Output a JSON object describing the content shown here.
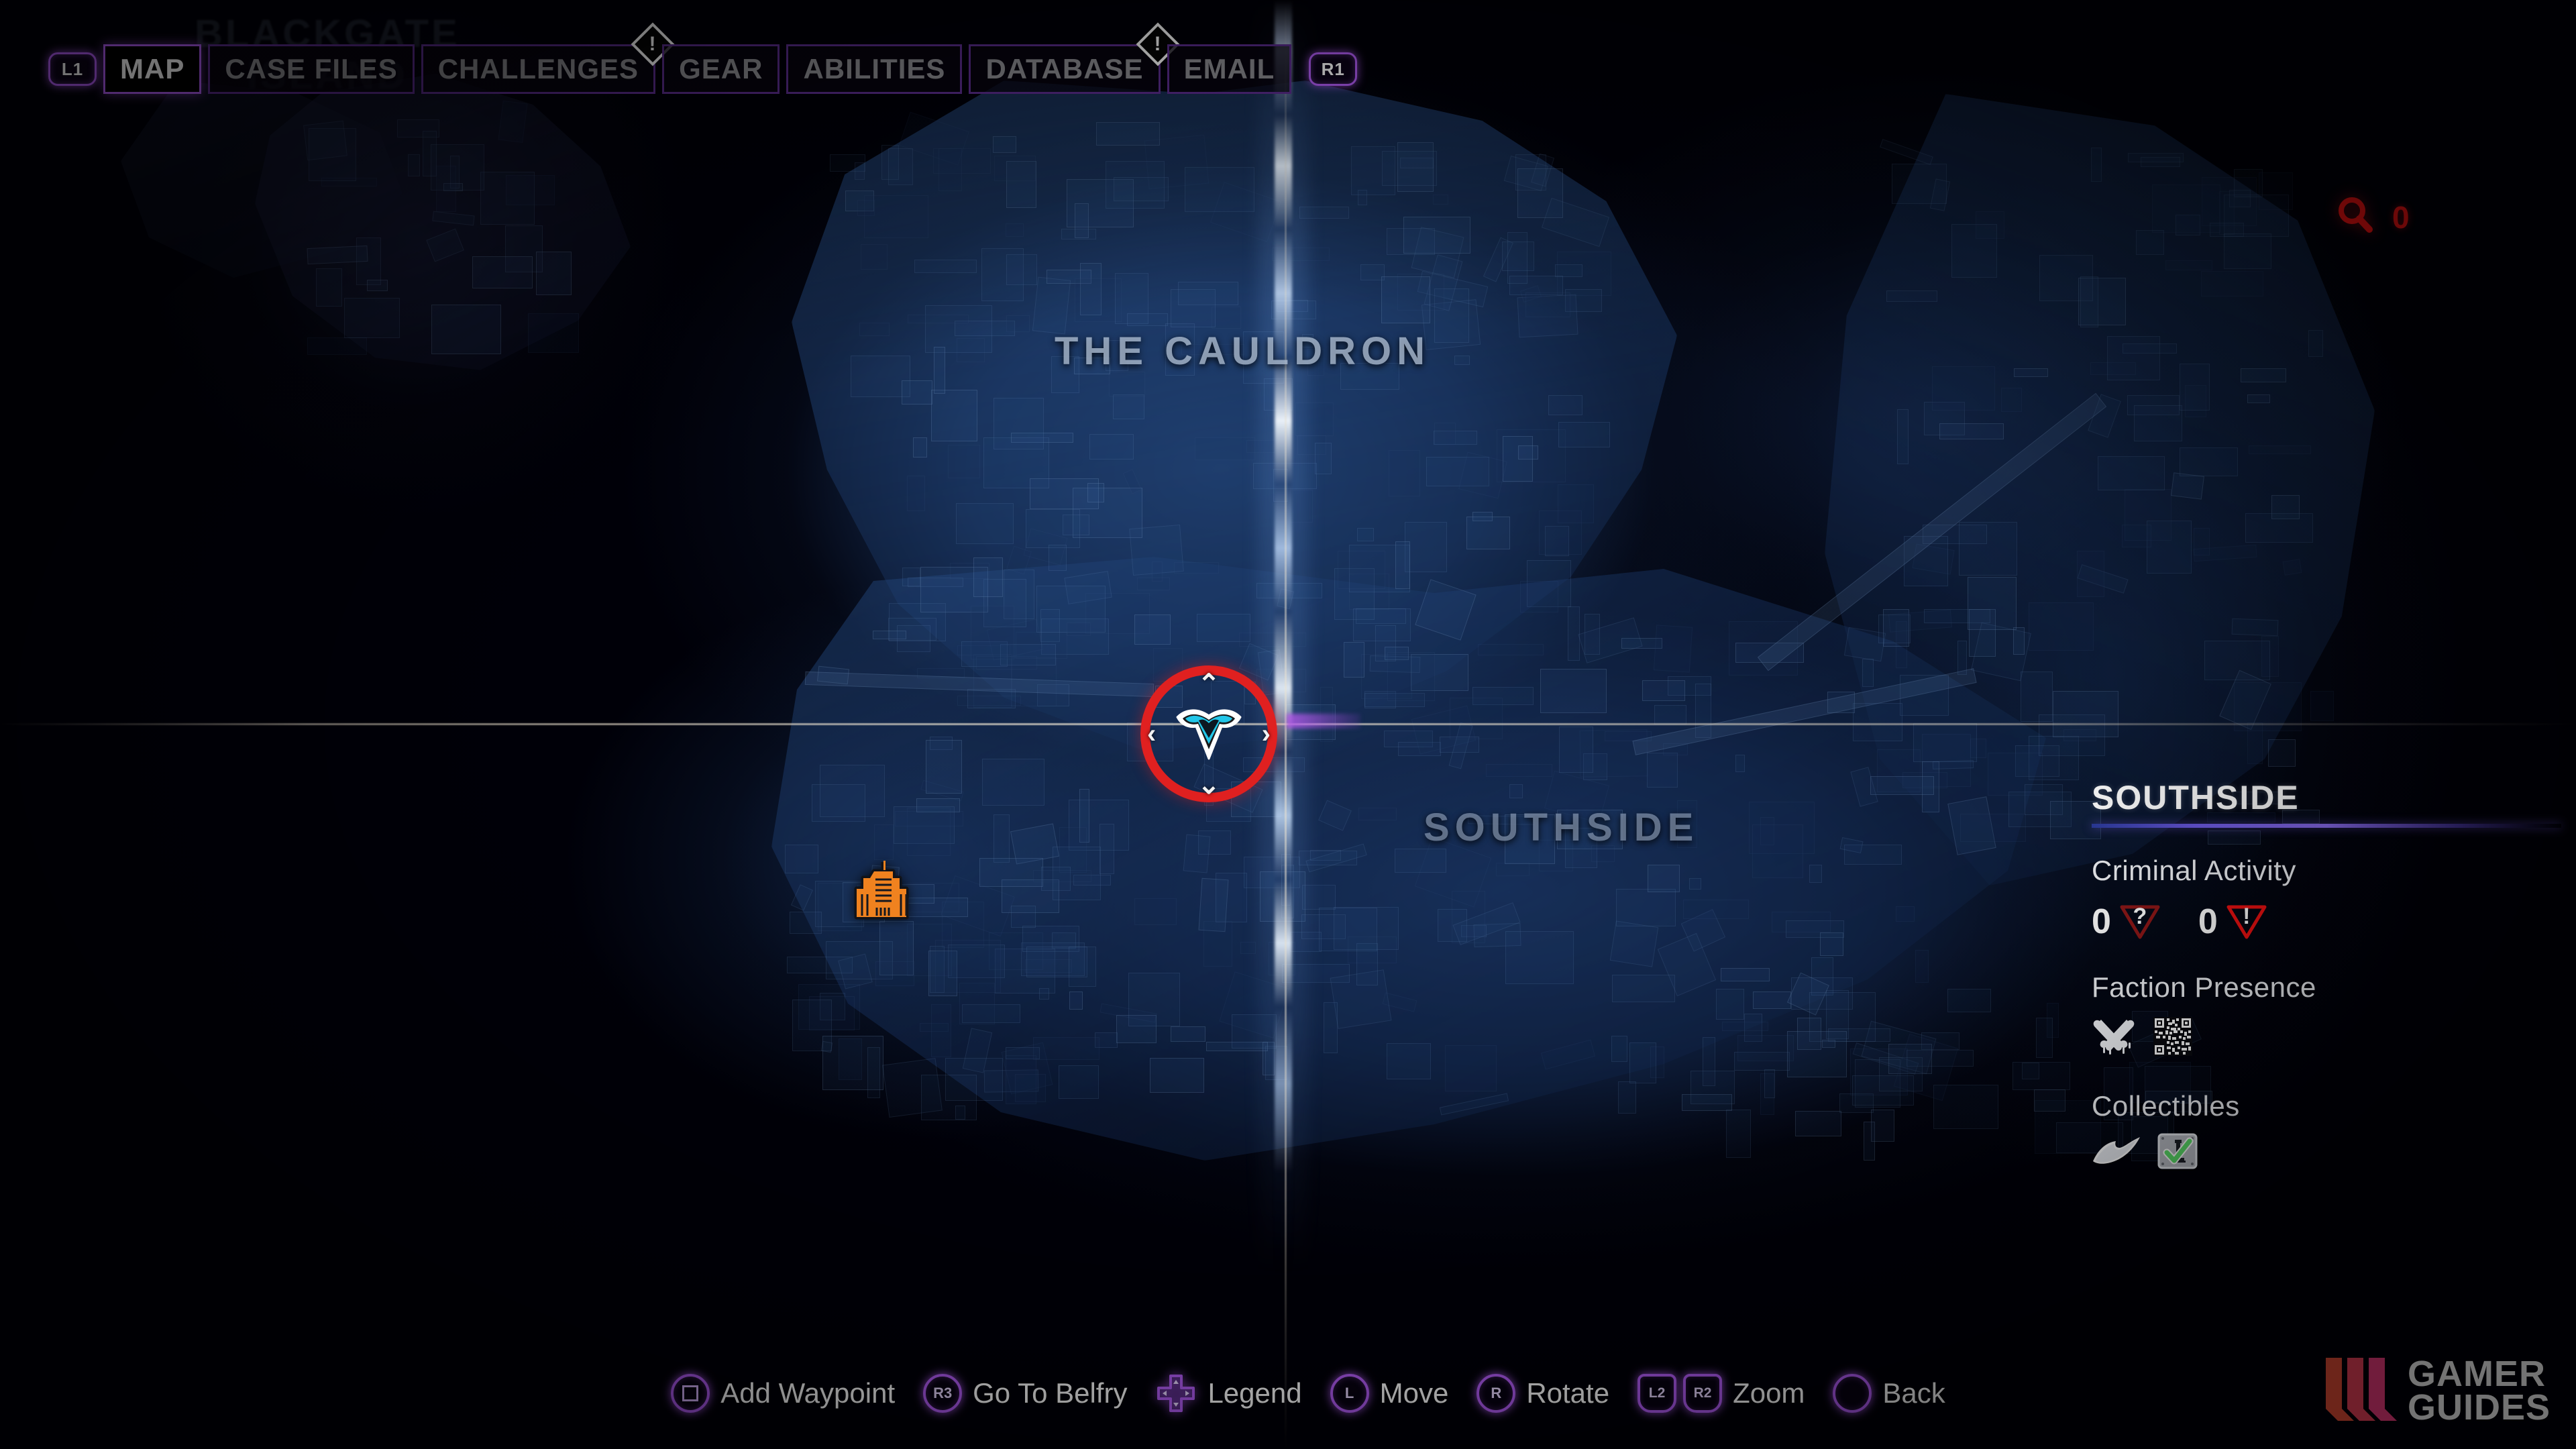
{
  "screen": {
    "district_ghost_label": "BLACKGATE\nISLAND"
  },
  "topnav": {
    "prev_key": "L1",
    "next_key": "R1",
    "tabs": [
      {
        "label": "MAP",
        "active": true,
        "alert": ""
      },
      {
        "label": "CASE FILES",
        "active": false,
        "alert": ""
      },
      {
        "label": "CHALLENGES",
        "active": false,
        "alert": "!"
      },
      {
        "label": "GEAR",
        "active": false,
        "alert": ""
      },
      {
        "label": "ABILITIES",
        "active": false,
        "alert": ""
      },
      {
        "label": "DATABASE",
        "active": false,
        "alert": "!"
      },
      {
        "label": "EMAIL",
        "active": false,
        "alert": ""
      }
    ]
  },
  "search_counter": {
    "icon": "magnifier-icon",
    "count": "0",
    "color": "#ee1111"
  },
  "map": {
    "region_labels": [
      {
        "name": "THE CAULDRON"
      },
      {
        "name": "SOUTHSIDE"
      }
    ],
    "player_cursor": {
      "emblem": "nightwing-emblem",
      "ring_color": "#e02020",
      "chevrons": {
        "up": "⌃",
        "down": "⌄",
        "left": "‹",
        "right": "›"
      }
    },
    "landmark": {
      "icon": "orange-building-icon",
      "color": "#f08020"
    }
  },
  "info_panel": {
    "title": "SOUTHSIDE",
    "accent_color": "#7a62f0",
    "sections": [
      {
        "label": "Criminal Activity",
        "stats": [
          {
            "value": "0",
            "icon": "unknown-crime-triangle-icon",
            "glyph": "?",
            "color": "#8e1818"
          },
          {
            "value": "0",
            "icon": "alert-crime-triangle-icon",
            "glyph": "!",
            "color": "#ee1111"
          }
        ]
      },
      {
        "label": "Faction Presence",
        "icons": [
          {
            "name": "crossed-bones-graffiti-icon"
          },
          {
            "name": "qr-code-icon"
          }
        ]
      },
      {
        "label": "Collectibles",
        "icons": [
          {
            "name": "batarang-icon"
          },
          {
            "name": "green-check-plaque-icon"
          }
        ]
      }
    ]
  },
  "bottom_bar": {
    "hints": [
      {
        "button": "square",
        "key": "",
        "label": "Add Waypoint"
      },
      {
        "button": "circle",
        "key": "R3",
        "label": "Go To Belfry"
      },
      {
        "button": "dpad",
        "key": "",
        "label": "Legend"
      },
      {
        "button": "circle",
        "key": "L",
        "label": "Move"
      },
      {
        "button": "circle",
        "key": "R",
        "label": "Rotate"
      },
      {
        "button": "triggers",
        "key": "L2 R2",
        "key_left": "L2",
        "key_right": "R2",
        "label": "Zoom"
      },
      {
        "button": "circle",
        "key": "",
        "label": "Back"
      }
    ]
  },
  "watermark": {
    "line1": "GAMER",
    "line2": "GUIDES"
  }
}
